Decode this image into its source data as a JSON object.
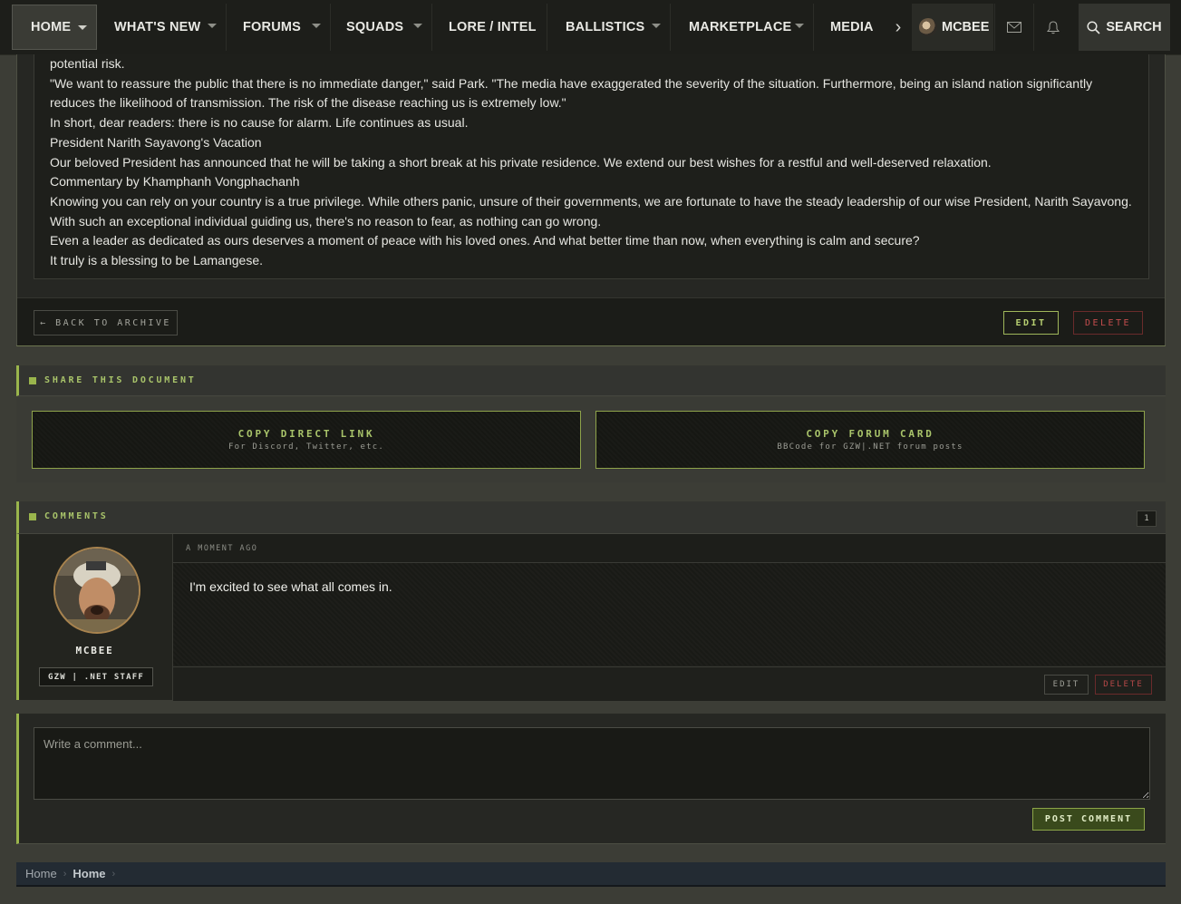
{
  "nav": {
    "items": [
      {
        "label": "HOME"
      },
      {
        "label": "WHAT'S NEW"
      },
      {
        "label": "FORUMS"
      },
      {
        "label": "SQUADS"
      },
      {
        "label": "LORE / INTEL"
      },
      {
        "label": "BALLISTICS"
      },
      {
        "label": "MARKETPLACE"
      },
      {
        "label": "MEDIA"
      }
    ],
    "user": "MCBEE",
    "search_label": "SEARCH"
  },
  "article": {
    "paragraphs": [
      "potential risk.",
      "\"We want to reassure the public that there is no immediate danger,\" said Park. \"The media have exaggerated the severity of the situation. Furthermore, being an island nation significantly reduces the likelihood of transmission. The risk of the disease reaching us is extremely low.\"",
      "In short, dear readers: there is no cause for alarm. Life continues as usual.",
      "President Narith Sayavong's Vacation",
      "Our beloved President has announced that he will be taking a short break at his private residence. We extend our best wishes for a restful and well-deserved relaxation.",
      "Commentary by Khamphanh Vongphachanh",
      "Knowing you can rely on your country is a true privilege. While others panic, unsure of their governments, we are fortunate to have the steady leadership of our wise President, Narith Sayavong. With such an exceptional individual guiding us, there's no reason to fear, as nothing can go wrong.",
      "Even a leader as dedicated as ours deserves a moment of peace with his loved ones. And what better time than now, when everything is calm and secure?",
      "It truly is a blessing to be Lamangese."
    ],
    "back_label": "← BACK TO ARCHIVE",
    "edit_label": "EDIT",
    "delete_label": "DELETE"
  },
  "share": {
    "title": "SHARE THIS DOCUMENT",
    "direct_link": {
      "label": "COPY DIRECT LINK",
      "sub": "For Discord, Twitter, etc."
    },
    "forum_card": {
      "label": "COPY FORUM CARD",
      "sub": "BBCode for GZW|.NET forum posts"
    }
  },
  "comments": {
    "title": "COMMENTS",
    "count": "1",
    "items": [
      {
        "username": "MCBEE",
        "badge": "GZW | .NET STAFF",
        "time": "A MOMENT AGO",
        "text": "I'm excited to see what all comes in.",
        "edit_label": "EDIT",
        "delete_label": "DELETE"
      }
    ],
    "new_placeholder": "Write a comment...",
    "post_label": "POST COMMENT"
  },
  "breadcrumb": {
    "items": [
      "Home",
      "Home"
    ]
  },
  "colors": {
    "accent": "#9ab54c",
    "danger": "#c44d4d",
    "background": "#3c3d36"
  }
}
